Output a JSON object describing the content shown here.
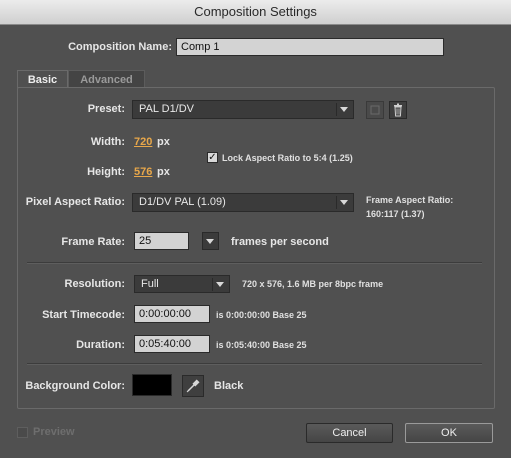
{
  "window": {
    "title": "Composition Settings"
  },
  "comp_name": {
    "label": "Composition Name:",
    "value": "Comp 1"
  },
  "tabs": [
    {
      "label": "Basic",
      "active": true
    },
    {
      "label": "Advanced",
      "active": false
    }
  ],
  "preset": {
    "label": "Preset:",
    "value": "PAL D1/DV",
    "save_icon": "save-preset-icon",
    "delete_icon": "trash-icon"
  },
  "width": {
    "label": "Width:",
    "value": "720",
    "unit": "px"
  },
  "height": {
    "label": "Height:",
    "value": "576",
    "unit": "px"
  },
  "lock_aspect": {
    "label": "Lock Aspect Ratio to 5:4 (1.25)",
    "checked": true
  },
  "pixel_aspect": {
    "label": "Pixel Aspect Ratio:",
    "value": "D1/DV PAL (1.09)"
  },
  "frame_aspect": {
    "label": "Frame Aspect Ratio:",
    "value": "160:117 (1.37)"
  },
  "frame_rate": {
    "label": "Frame Rate:",
    "value": "25",
    "unit": "frames per second"
  },
  "resolution": {
    "label": "Resolution:",
    "value": "Full",
    "info": "720 x 576, 1.6 MB per 8bpc frame"
  },
  "start_timecode": {
    "label": "Start Timecode:",
    "value": "0:00:00:00",
    "info": "is 0:00:00:00  Base 25"
  },
  "duration": {
    "label": "Duration:",
    "value": "0:05:40:00",
    "info": "is 0:05:40:00  Base 25"
  },
  "background": {
    "label": "Background Color:",
    "color": "#000000",
    "color_name": "Black",
    "eyedropper_icon": "eyedropper-icon"
  },
  "footer": {
    "preview_label": "Preview",
    "cancel_label": "Cancel",
    "ok_label": "OK"
  },
  "colors": {
    "accent_scrub": "#e8a74a",
    "panel_bg": "#505050"
  }
}
